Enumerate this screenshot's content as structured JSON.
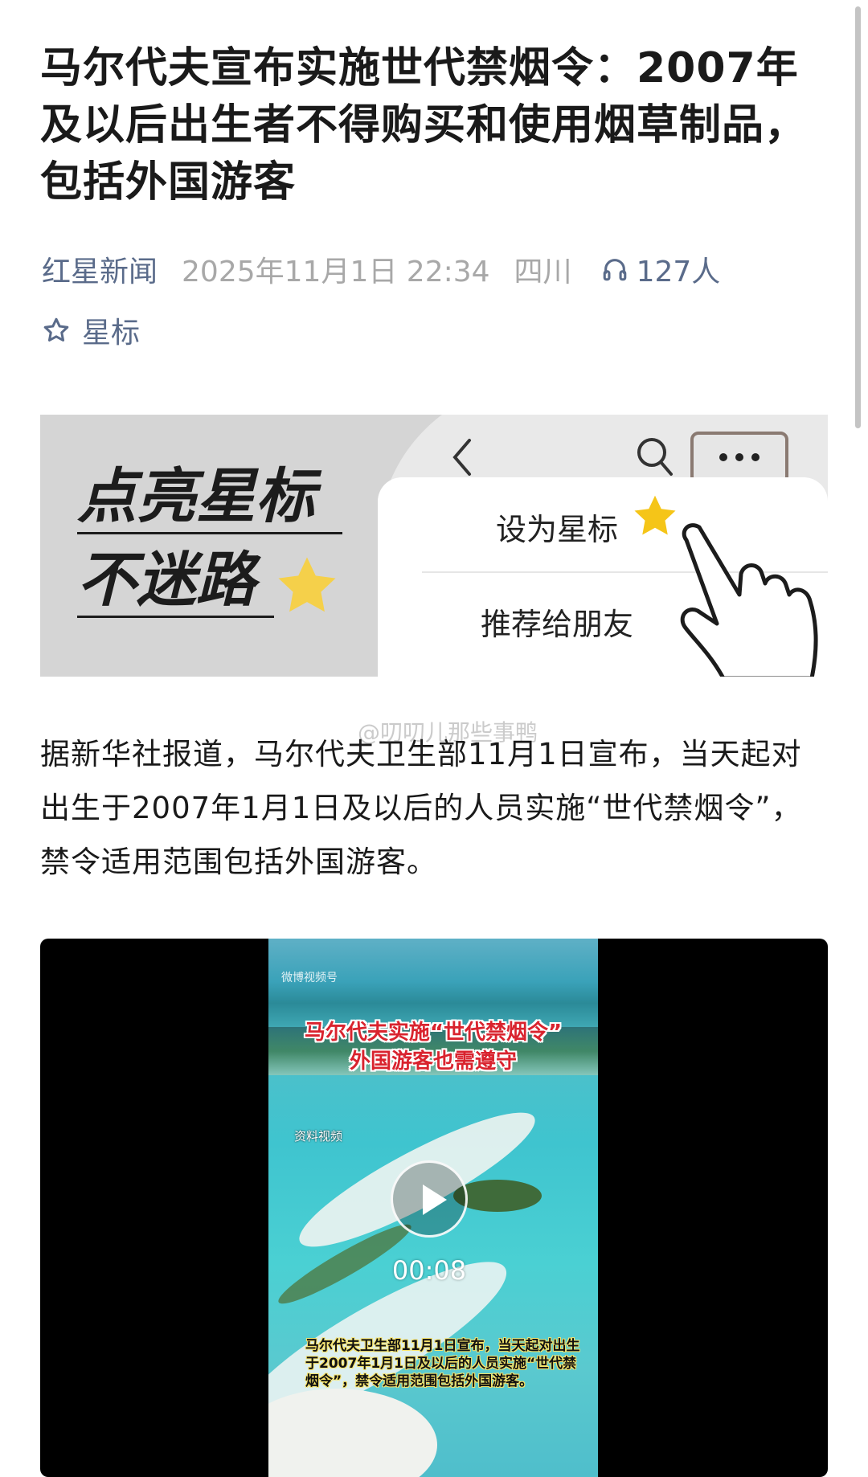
{
  "article": {
    "title": "马尔代夫宣布实施世代禁烟令：2007年及以后出生者不得购买和使用烟草制品，包括外国游客",
    "source": "红星新闻",
    "date": "2025年11月1日 22:34",
    "location": "四川",
    "listen_count": "127人",
    "star_label": "星标"
  },
  "banner": {
    "line1": "点亮星标",
    "line2": "不迷路",
    "menu_item_1": "设为星标",
    "menu_item_2": "推荐给朋友"
  },
  "body": {
    "paragraph": "据新华社报道，马尔代夫卫生部11月1日宣布，当天起对出生于2007年1月1日及以后的人员实施“世代禁烟令”，禁令适用范围包括外国游客。",
    "watermark": "@叨叨儿那些事鸭"
  },
  "video": {
    "logo": "微博视频号",
    "title_line1": "马尔代夫实施“世代禁烟令”",
    "title_line2": "外国游客也需遵守",
    "tag": "资料视频",
    "duration": "00:08",
    "caption": "马尔代夫卫生部11月1日宣布，当天起对出生于2007年1月1日及以后的人员实施“世代禁烟令”，禁令适用范围包括外国游客。"
  },
  "colors": {
    "meta_link": "#5a6b8a",
    "meta_gray": "#a8a8a8",
    "star_yellow": "#f5c518",
    "video_title_red": "#d9232e"
  }
}
